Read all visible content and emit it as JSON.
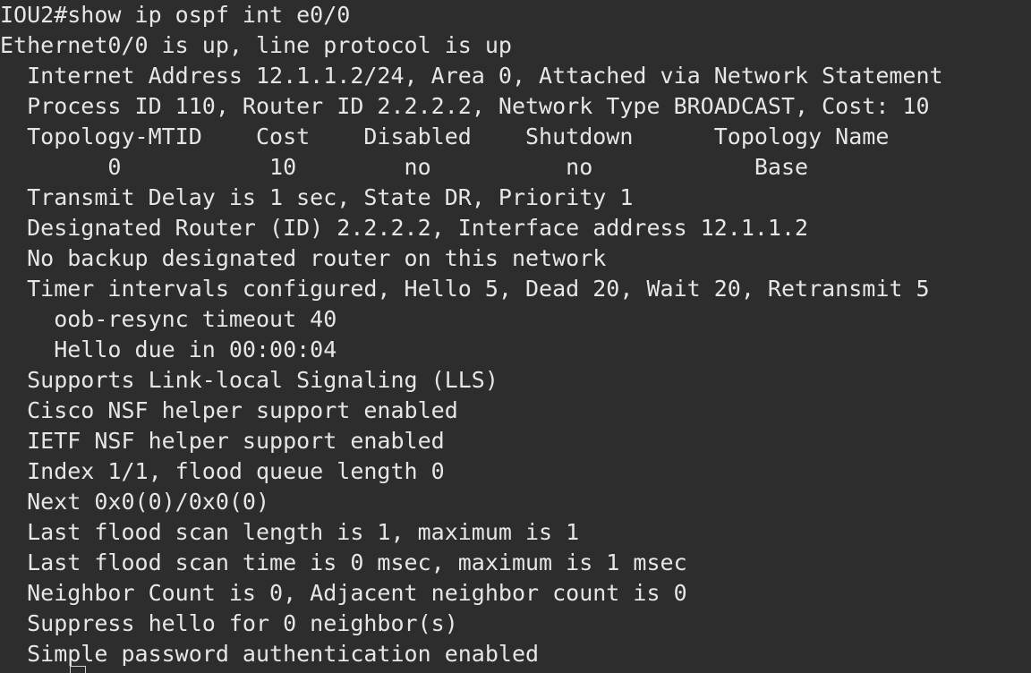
{
  "terminal": {
    "lines": [
      "IOU2#show ip ospf int e0/0",
      "Ethernet0/0 is up, line protocol is up",
      "  Internet Address 12.1.1.2/24, Area 0, Attached via Network Statement",
      "  Process ID 110, Router ID 2.2.2.2, Network Type BROADCAST, Cost: 10",
      "  Topology-MTID    Cost    Disabled    Shutdown      Topology Name",
      "        0           10        no          no            Base",
      "  Transmit Delay is 1 sec, State DR, Priority 1",
      "  Designated Router (ID) 2.2.2.2, Interface address 12.1.1.2",
      "  No backup designated router on this network",
      "  Timer intervals configured, Hello 5, Dead 20, Wait 20, Retransmit 5",
      "    oob-resync timeout 40",
      "    Hello due in 00:00:04",
      "  Supports Link-local Signaling (LLS)",
      "  Cisco NSF helper support enabled",
      "  IETF NSF helper support enabled",
      "  Index 1/1, flood queue length 0",
      "  Next 0x0(0)/0x0(0)",
      "  Last flood scan length is 1, maximum is 1",
      "  Last flood scan time is 0 msec, maximum is 1 msec",
      "  Neighbor Count is 0, Adjacent neighbor count is 0",
      "  Suppress hello for 0 neighbor(s)",
      "  Simple password authentication enabled"
    ]
  },
  "colors": {
    "background": "#2d2d2d",
    "text": "#e6e6e6"
  }
}
